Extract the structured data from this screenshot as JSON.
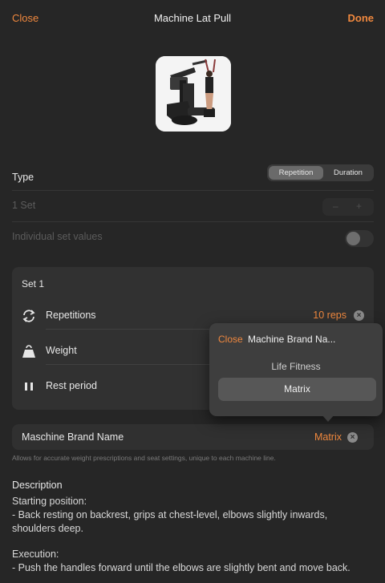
{
  "topbar": {
    "close": "Close",
    "title": "Machine Lat Pull",
    "done": "Done"
  },
  "image": {
    "icon": "lat-pull-machine-photo"
  },
  "type_row": {
    "label": "Type",
    "options": [
      "Repetition",
      "Duration"
    ],
    "selected": "Repetition"
  },
  "sets_row": {
    "label": "1 Set",
    "minus": "–",
    "plus": "+"
  },
  "individual_row": {
    "label": "Individual set values",
    "enabled": false
  },
  "set_card": {
    "title": "Set 1",
    "rows": [
      {
        "label": "Repetitions",
        "value": "10 reps",
        "icon": "repeat-icon"
      },
      {
        "label": "Weight",
        "value": "",
        "icon": "weight-icon"
      },
      {
        "label": "Rest period",
        "value": "",
        "icon": "pause-icon"
      }
    ]
  },
  "brand_row": {
    "label": "Maschine Brand Name",
    "value": "Matrix"
  },
  "hint": "Allows for accurate weight prescriptions and seat settings, unique to each machine line.",
  "description": {
    "heading": "Description",
    "start_title": "Starting position:",
    "start_text": "- Back resting on backrest, grips at chest-level, elbows slightly inwards, shoulders deep.",
    "exec_title": "Execution:",
    "exec_text": "- Push the handles forward until the elbows are slightly bent and move back."
  },
  "popover": {
    "close": "Close",
    "title": "Machine Brand Na...",
    "options": [
      "Life Fitness",
      "Matrix"
    ],
    "selected": "Matrix"
  },
  "colors": {
    "accent": "#f0883e",
    "background": "#262626",
    "card": "#313131"
  }
}
